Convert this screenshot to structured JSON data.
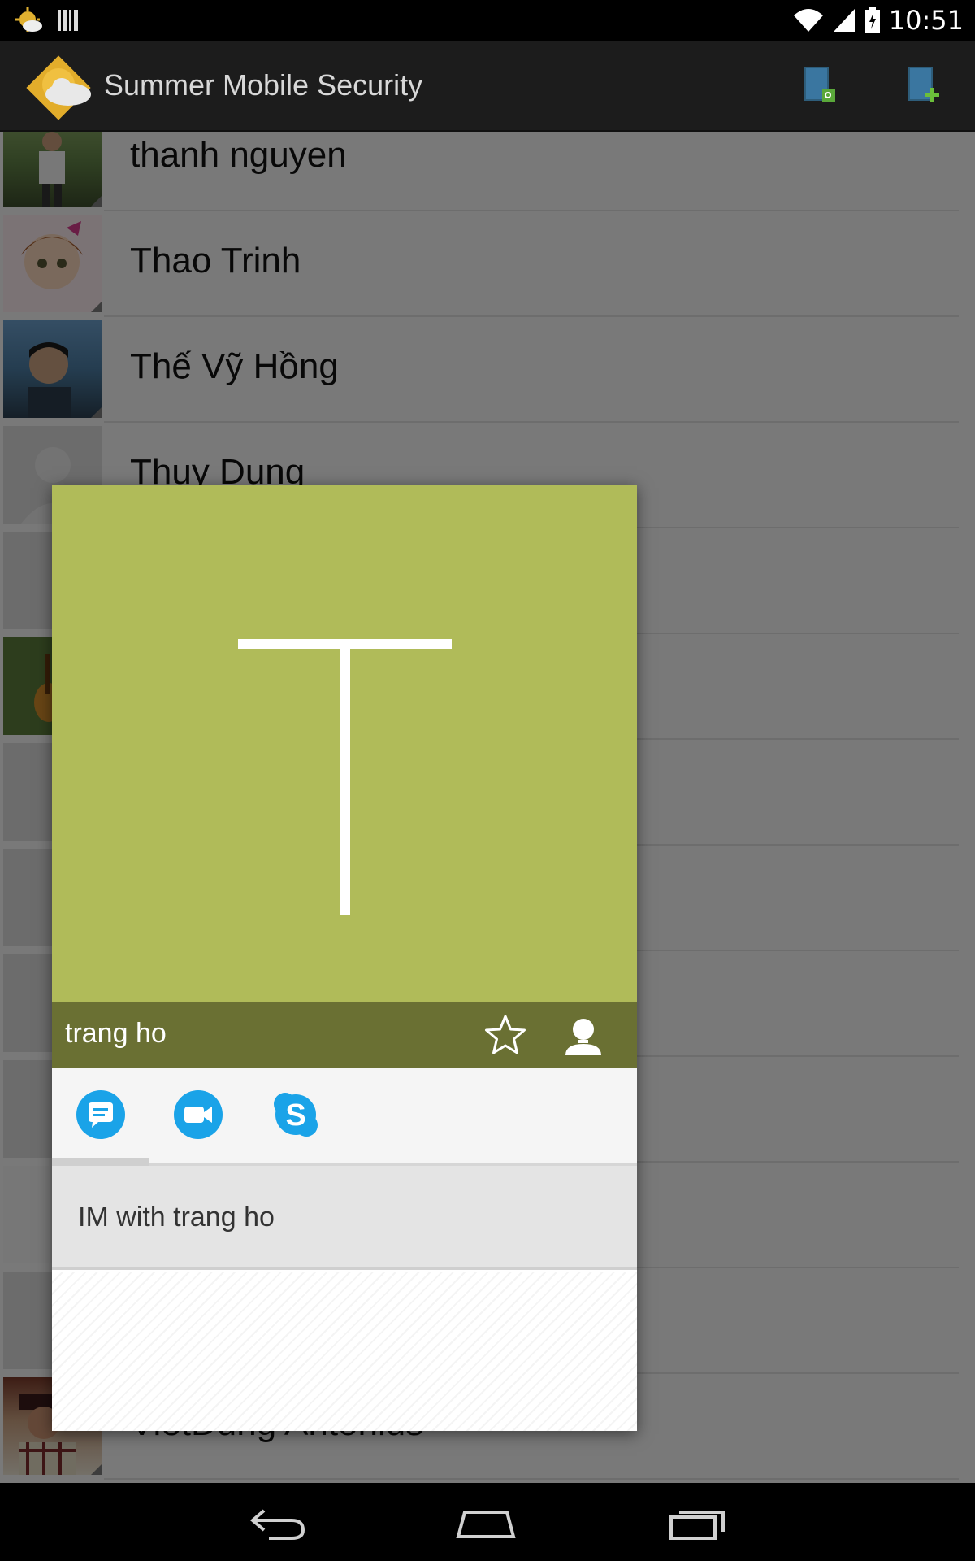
{
  "status_bar": {
    "time": "10:51",
    "icons": [
      "weather-notification-icon",
      "barcode-notification-icon",
      "wifi-icon",
      "signal-icon",
      "battery-charging-icon"
    ]
  },
  "action_bar": {
    "title": "Summer Mobile Security",
    "actions": [
      "search-contacts-icon",
      "add-contact-icon"
    ]
  },
  "contacts": [
    {
      "name": "thanh nguyen",
      "avatar": "photo"
    },
    {
      "name": "Thao Trinh",
      "avatar": "photo"
    },
    {
      "name": "Thế Vỹ Hồng",
      "avatar": "photo"
    },
    {
      "name": "Thuy Dung",
      "avatar": "default"
    },
    {
      "name": "",
      "avatar": "default"
    },
    {
      "name": "",
      "avatar": "photo"
    },
    {
      "name": "",
      "avatar": "default"
    },
    {
      "name": "",
      "avatar": "default"
    },
    {
      "name": "",
      "avatar": "default"
    },
    {
      "name": "",
      "avatar": "default"
    },
    {
      "name": "",
      "avatar": "default"
    },
    {
      "name": "",
      "avatar": "default"
    },
    {
      "name": "VietDung Antonius",
      "avatar": "photo"
    }
  ],
  "quick_contact": {
    "letter": "T",
    "name": "trang ho",
    "photo_color": "#b0bb59",
    "namebar_color": "#6a7033",
    "tabs": [
      "chat-icon",
      "video-call-icon",
      "skype-icon"
    ],
    "action_label": "IM with trang ho"
  },
  "nav_bar": {
    "buttons": [
      "back-icon",
      "home-icon",
      "recents-icon"
    ]
  }
}
